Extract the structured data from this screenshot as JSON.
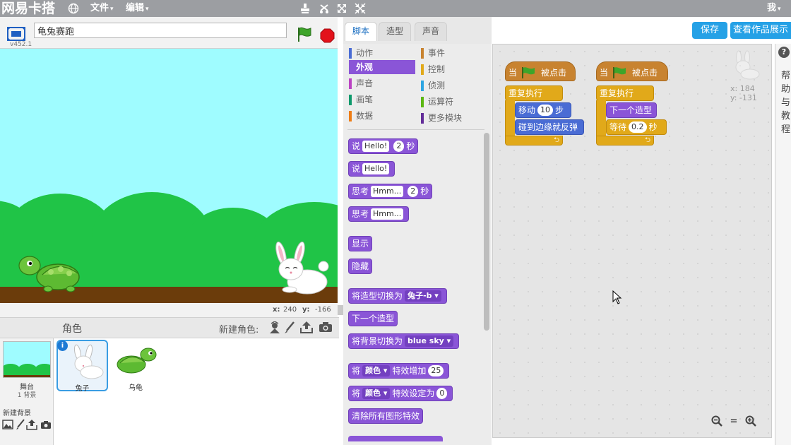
{
  "menubar": {
    "brand": "网易卡搭",
    "file_label": "文件",
    "edit_label": "编辑",
    "user_label": "我",
    "caret": "▾"
  },
  "stage": {
    "project_title": "龟兔赛跑",
    "version": "v452.1",
    "coord_x_label": "x:",
    "coord_x": "240",
    "coord_y_label": "y:",
    "coord_y": "-166",
    "sky_color": "#9ffcff",
    "hill_color": "#20c447",
    "ground_color": "#6b3c0b"
  },
  "sprites": {
    "header_label": "角色",
    "new_sprite_label": "新建角色:",
    "stage_name": "舞台",
    "stage_backdrops": "1 背景",
    "new_backdrop_label": "新建背景",
    "items": [
      {
        "name": "兔子",
        "selected": true
      },
      {
        "name": "乌龟",
        "selected": false
      }
    ]
  },
  "tabs": [
    {
      "label": "脚本",
      "active": true
    },
    {
      "label": "造型",
      "active": false
    },
    {
      "label": "声音",
      "active": false
    }
  ],
  "categories_left": [
    {
      "label": "动作",
      "color": "#4a6cd4",
      "active": false
    },
    {
      "label": "外观",
      "color": "#8a55d7",
      "active": true
    },
    {
      "label": "声音",
      "color": "#bb42c3",
      "active": false
    },
    {
      "label": "画笔",
      "color": "#0e9a6c",
      "active": false
    },
    {
      "label": "数据",
      "color": "#ee7d16",
      "active": false
    }
  ],
  "categories_right": [
    {
      "label": "事件",
      "color": "#c88330"
    },
    {
      "label": "控制",
      "color": "#e1a91a"
    },
    {
      "label": "侦测",
      "color": "#2ca5e2"
    },
    {
      "label": "运算符",
      "color": "#5cb712"
    },
    {
      "label": "更多模块",
      "color": "#632d99"
    }
  ],
  "palette_blocks": {
    "say_secs": {
      "label": "说",
      "text": "Hello!",
      "secs": "2",
      "unit": "秒"
    },
    "say": {
      "label": "说",
      "text": "Hello!"
    },
    "think_secs": {
      "label": "思考",
      "text": "Hmm...",
      "secs": "2",
      "unit": "秒"
    },
    "think": {
      "label": "思考",
      "text": "Hmm..."
    },
    "show": "显示",
    "hide": "隐藏",
    "switch_costume": {
      "label": "将造型切换为",
      "value": "兔子-b"
    },
    "next_costume": "下一个造型",
    "switch_backdrop": {
      "label": "将背景切换为",
      "value": "blue sky"
    },
    "change_effect": {
      "label": "将",
      "effect": "颜色",
      "mid": "特效增加",
      "value": "25"
    },
    "set_effect": {
      "label": "将",
      "effect": "颜色",
      "mid": "特效设定为",
      "value": "0"
    },
    "clear_effects": "清除所有图形特效"
  },
  "scripts": {
    "script1": {
      "when": "当",
      "clicked": "被点击",
      "forever": "重复执行",
      "move_label": "移动",
      "move_steps": "10",
      "move_unit": "步",
      "bounce": "碰到边缘就反弹"
    },
    "script2": {
      "when": "当",
      "clicked": "被点击",
      "forever": "重复执行",
      "next_costume": "下一个造型",
      "wait_label": "等待",
      "wait_value": "0.2",
      "wait_unit": "秒"
    },
    "sprite_x": "x: 184",
    "sprite_y": "y: -131"
  },
  "header_buttons": {
    "save": "保存",
    "view_page": "查看作品展示"
  },
  "help": {
    "icon": "?",
    "text": "帮助与教程"
  },
  "zoom": {
    "zoom_out": "zoom-out-icon",
    "reset": "=",
    "zoom_in": "zoom-in-icon"
  }
}
